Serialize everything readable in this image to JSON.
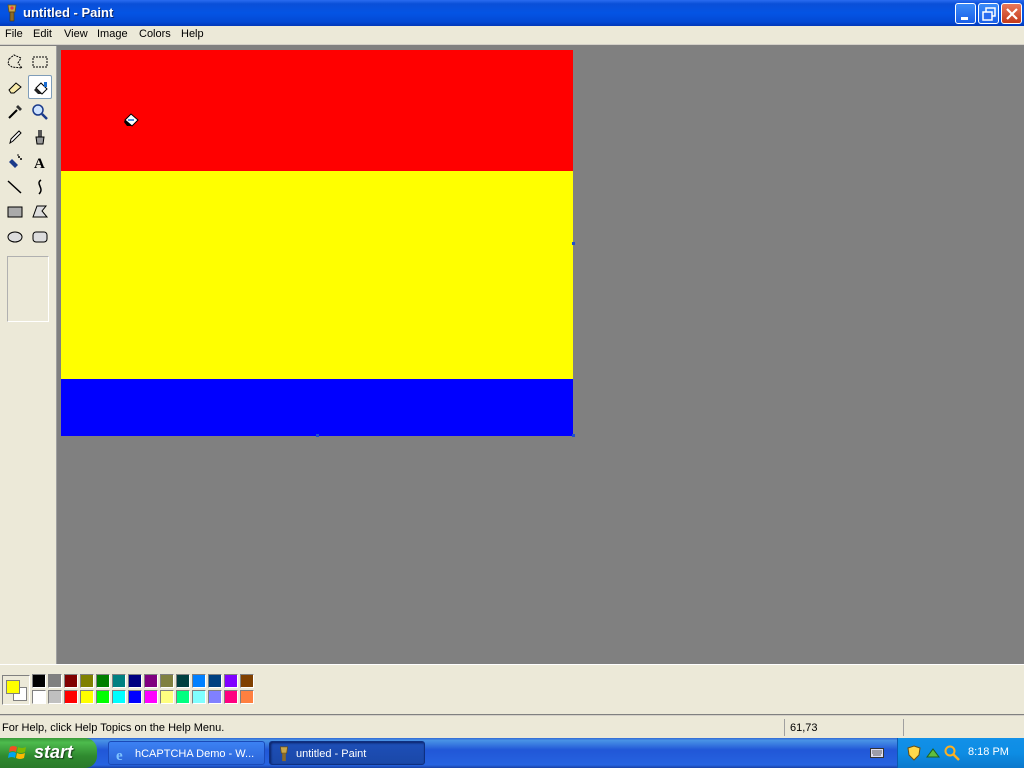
{
  "window": {
    "title": "untitled - Paint"
  },
  "menu": [
    "File",
    "Edit",
    "View",
    "Image",
    "Colors",
    "Help"
  ],
  "tools": [
    {
      "name": "free-form-select"
    },
    {
      "name": "select"
    },
    {
      "name": "eraser"
    },
    {
      "name": "fill-with-color",
      "selected": true
    },
    {
      "name": "pick-color"
    },
    {
      "name": "magnifier"
    },
    {
      "name": "pencil"
    },
    {
      "name": "brush"
    },
    {
      "name": "airbrush"
    },
    {
      "name": "text"
    },
    {
      "name": "line"
    },
    {
      "name": "curve"
    },
    {
      "name": "rectangle"
    },
    {
      "name": "polygon"
    },
    {
      "name": "ellipse"
    },
    {
      "name": "rounded-rectangle"
    }
  ],
  "canvas": {
    "bands": [
      {
        "name": "red",
        "color": "#ff0000"
      },
      {
        "name": "yellow",
        "color": "#ffff00"
      },
      {
        "name": "blue",
        "color": "#0000ff"
      }
    ]
  },
  "palette": {
    "foreground": "#ffff00",
    "background": "#ffffff",
    "row1": [
      "#000000",
      "#808080",
      "#800000",
      "#808000",
      "#008000",
      "#008080",
      "#000080",
      "#800080",
      "#808040",
      "#004040",
      "#0080ff",
      "#004080",
      "#8000ff",
      "#804000"
    ],
    "row2": [
      "#ffffff",
      "#c0c0c0",
      "#ff0000",
      "#ffff00",
      "#00ff00",
      "#00ffff",
      "#0000ff",
      "#ff00ff",
      "#ffff80",
      "#00ff80",
      "#80ffff",
      "#8080ff",
      "#ff0080",
      "#ff8040"
    ]
  },
  "status": {
    "help_text": "For Help, click Help Topics on the Help Menu.",
    "coords": "61,73"
  },
  "taskbar": {
    "start_label": "start",
    "tasks": [
      {
        "label": "hCAPTCHA Demo - W...",
        "icon": "ie-icon",
        "active": false
      },
      {
        "label": "untitled - Paint",
        "icon": "paint-icon",
        "active": true
      }
    ],
    "clock": "8:18 PM"
  }
}
